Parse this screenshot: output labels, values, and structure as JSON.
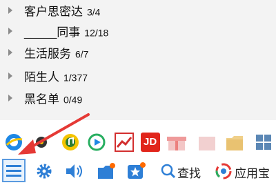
{
  "contact_groups": [
    {
      "name": "客户思密达",
      "count": "3/4"
    },
    {
      "name": "_____同事",
      "count": "12/18"
    },
    {
      "name": "生活服务",
      "count": "6/7"
    },
    {
      "name": "陌生人",
      "count": "1/377"
    },
    {
      "name": "黑名单",
      "count": "0/49"
    }
  ],
  "app_bar": [
    {
      "icon": "browser-icon",
      "color": "#1e88e5"
    },
    {
      "icon": "music-icon",
      "color": "#f5c400"
    },
    {
      "icon": "video-icon",
      "color": "#27ae60"
    },
    {
      "icon": "stocks-icon",
      "color": "#d32f2f"
    },
    {
      "icon": "jd-icon",
      "color": "#e1251b",
      "label": "JD"
    },
    {
      "icon": "gift-icon",
      "color": "#e53935"
    },
    {
      "icon": "folder-icon",
      "color": "#f0a832"
    },
    {
      "icon": "grid-apps-icon",
      "color": "#5b87b5"
    }
  ],
  "toolbar": {
    "search_label": "查找",
    "appstore_label": "应用宝"
  },
  "colors": {
    "accent": "#2e7fd6",
    "arrow": "#e53935"
  }
}
